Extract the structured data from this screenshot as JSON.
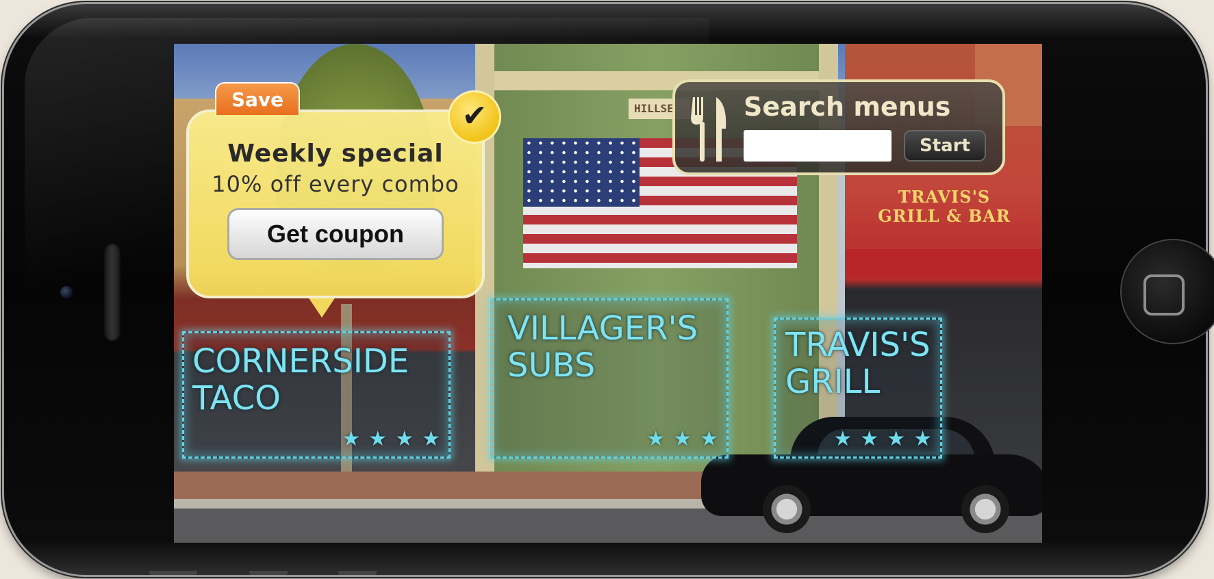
{
  "coupon": {
    "save_label": "Save",
    "heading": "Weekly special",
    "subtext": "10% off every combo",
    "button_label": "Get coupon",
    "check_icon": "✔"
  },
  "search": {
    "title": "Search menus",
    "input_value": "",
    "start_label": "Start"
  },
  "scene": {
    "building_sign": "TRAVIS'S\nGRILL & BAR",
    "partial_sign": "HILLSE"
  },
  "restaurants": [
    {
      "name": "CORNERSIDE\nTACO",
      "rating": 4
    },
    {
      "name": "VILLAGER'S\nSUBS",
      "rating": 3
    },
    {
      "name": "TRAVIS'S\nGRILL",
      "rating": 4
    }
  ],
  "colors": {
    "ar_outline": "#5fd3e6",
    "coupon_yellow": "#f6de5a",
    "save_orange": "#e86f1e"
  },
  "icons": [
    "check-icon",
    "fork-knife-icon",
    "star-icon",
    "home-button-icon"
  ]
}
